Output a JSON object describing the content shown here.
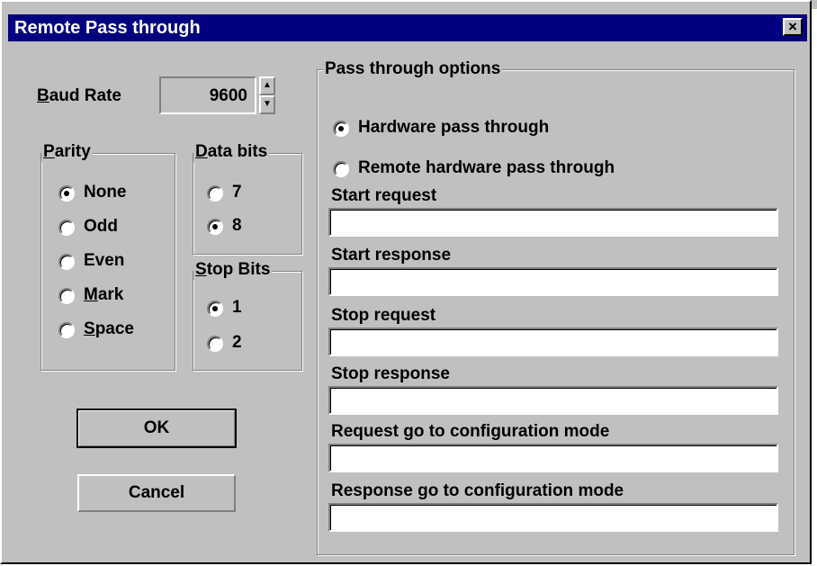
{
  "window": {
    "title": "Remote Pass through",
    "close_glyph": "×"
  },
  "baud": {
    "label_accel": "B",
    "label_rest": "aud Rate",
    "value": "9600",
    "spin_up": "▲",
    "spin_down": "▼"
  },
  "parity": {
    "title_accel": "P",
    "title_rest": "arity",
    "options": [
      {
        "pre": "",
        "accel": "",
        "post": "None",
        "selected": true
      },
      {
        "pre": "",
        "accel": "",
        "post": "Odd",
        "selected": false
      },
      {
        "pre": "",
        "accel": "",
        "post": "Even",
        "selected": false
      },
      {
        "pre": "",
        "accel": "M",
        "post": "ark",
        "selected": false
      },
      {
        "pre": "",
        "accel": "S",
        "post": "pace",
        "selected": false
      }
    ]
  },
  "data_bits": {
    "title_accel": "D",
    "title_rest": "ata bits",
    "options": [
      {
        "label": "7",
        "selected": false
      },
      {
        "label": "8",
        "selected": true
      }
    ]
  },
  "stop_bits": {
    "title_accel": "S",
    "title_rest": "top Bits",
    "options": [
      {
        "label": "1",
        "selected": true
      },
      {
        "label": "2",
        "selected": false
      }
    ]
  },
  "pass_through": {
    "title": "Pass through options",
    "modes": [
      {
        "label": "Hardware pass through",
        "selected": true
      },
      {
        "label": "Remote hardware pass through",
        "selected": false
      }
    ],
    "fields": [
      {
        "label": "Start request",
        "value": ""
      },
      {
        "label": "Start response",
        "value": ""
      },
      {
        "label": "Stop request",
        "value": ""
      },
      {
        "label": "Stop response",
        "value": ""
      },
      {
        "label": "Request go to configuration mode",
        "value": ""
      },
      {
        "label": "Response go to configuration mode",
        "value": ""
      }
    ]
  },
  "buttons": {
    "ok": "OK",
    "cancel": "Cancel"
  },
  "colors": {
    "titlebar": "#000080",
    "face": "#c0c0c0"
  }
}
